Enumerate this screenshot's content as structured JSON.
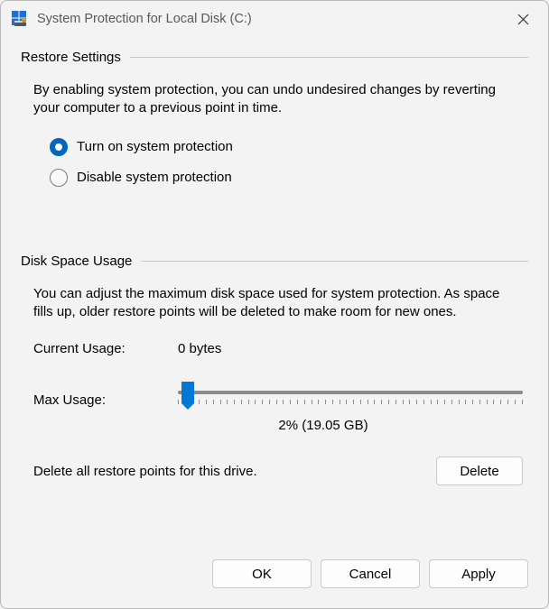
{
  "titlebar": {
    "title": "System Protection for Local Disk (C:)"
  },
  "restore": {
    "header": "Restore Settings",
    "description": "By enabling system protection, you can undo undesired changes by reverting your computer to a previous point in time.",
    "option_on": "Turn on system protection",
    "option_off": "Disable system protection"
  },
  "disk": {
    "header": "Disk Space Usage",
    "description": "You can adjust the maximum disk space used for system protection. As space fills up, older restore points will be deleted to make room for new ones.",
    "current_usage_label": "Current Usage:",
    "current_usage_value": "0 bytes",
    "max_usage_label": "Max Usage:",
    "slider_value_text": "2% (19.05 GB)",
    "delete_text": "Delete all restore points for this drive.",
    "delete_button": "Delete"
  },
  "footer": {
    "ok": "OK",
    "cancel": "Cancel",
    "apply": "Apply"
  }
}
